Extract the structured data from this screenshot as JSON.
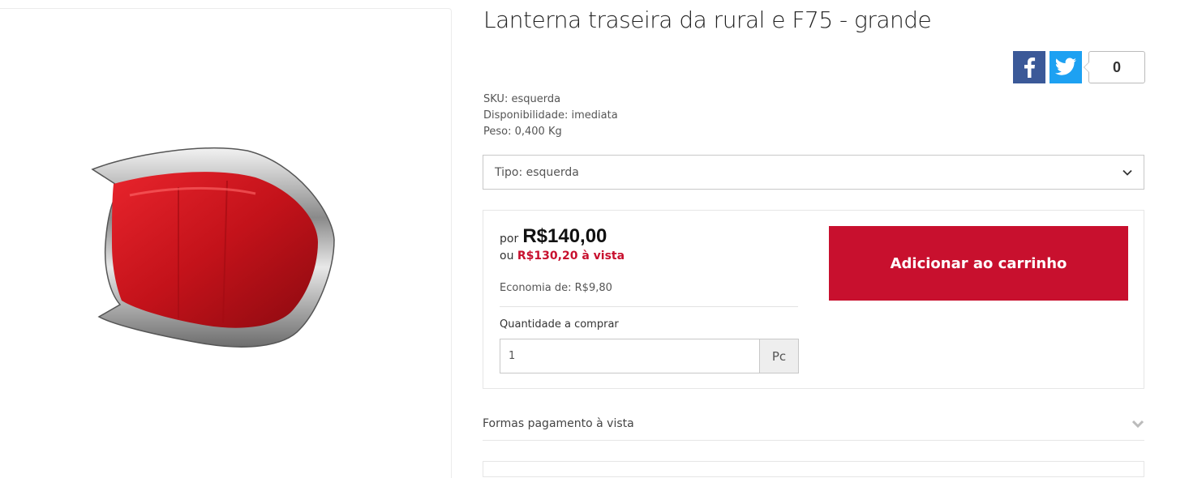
{
  "product": {
    "title": "Lanterna traseira da rural e F75 - grande",
    "image_alt": "Lanterna traseira vermelha com moldura cromada"
  },
  "share": {
    "facebook_icon": "facebook-icon",
    "twitter_icon": "twitter-icon",
    "count": "0"
  },
  "meta": {
    "sku": "SKU: esquerda",
    "availability": "Disponibilidade: imediata",
    "weight": "Peso: 0,400 Kg"
  },
  "variant": {
    "selected": "Tipo: esquerda"
  },
  "pricing": {
    "prefix": "por",
    "price": "R$140,00",
    "cash_prefix": "ou",
    "cash_price": "R$130,20 à vista",
    "savings": "Economia de: R$9,80"
  },
  "quantity": {
    "label": "Quantidade a comprar",
    "value": "1",
    "unit": "Pc"
  },
  "cart": {
    "add_label": "Adicionar ao carrinho"
  },
  "accordion": {
    "payment_label": "Formas pagamento à vista"
  },
  "colors": {
    "accent": "#c8102e",
    "facebook": "#3b5998",
    "twitter": "#1da1f2"
  }
}
